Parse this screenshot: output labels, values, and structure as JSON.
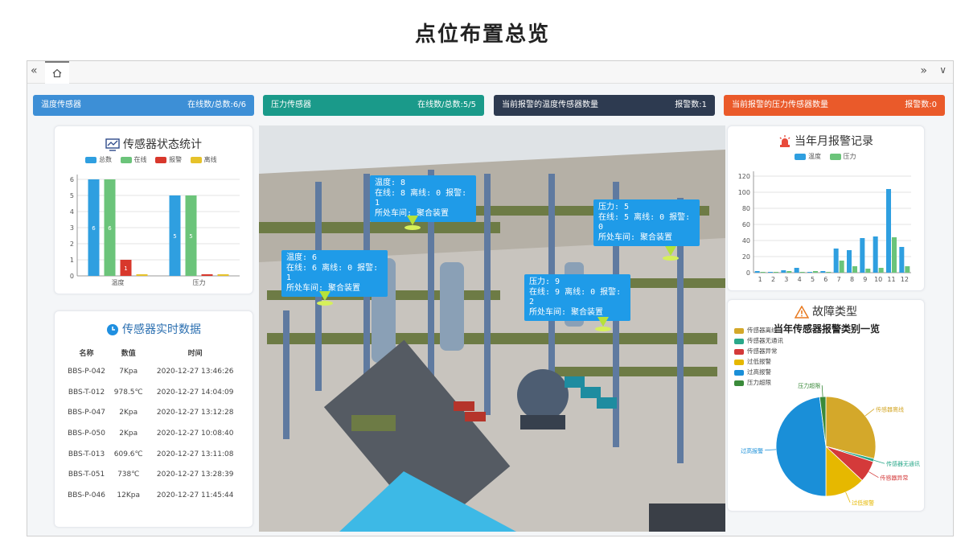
{
  "page_title": "点位布置总览",
  "tabs": {
    "prev": "«",
    "home_icon": "home-icon",
    "next": "»",
    "menu": "∨"
  },
  "stat_bars": [
    {
      "label": "温度传感器",
      "value": "在线数/总数:6/6",
      "color": "#3d8fd6"
    },
    {
      "label": "压力传感器",
      "value": "在线数/总数:5/5",
      "color": "#1a9a8a"
    },
    {
      "label": "当前报警的温度传感器数量",
      "value": "报警数:1",
      "color": "#2d3a50"
    },
    {
      "label": "当前报警的压力传感器数量",
      "value": "报警数:0",
      "color": "#ea5a2a"
    }
  ],
  "status_panel": {
    "title": "传感器状态统计",
    "icon": "monitor-chart-icon",
    "legend": [
      "总数",
      "在线",
      "报警",
      "离线"
    ],
    "legend_colors": [
      "#2f9fe0",
      "#6bc47a",
      "#d8382c",
      "#e6c22a"
    ]
  },
  "realtime_panel": {
    "title": "传感器实时数据",
    "icon": "clock-icon",
    "columns": [
      "名称",
      "数值",
      "时间"
    ],
    "rows": [
      [
        "BBS-P-042",
        "7Kpa",
        "2020-12-27 13:46:26"
      ],
      [
        "BBS-T-012",
        "978.5℃",
        "2020-12-27 14:04:09"
      ],
      [
        "BBS-P-047",
        "2Kpa",
        "2020-12-27 13:12:28"
      ],
      [
        "BBS-P-050",
        "2Kpa",
        "2020-12-27 10:08:40"
      ],
      [
        "BBS-T-013",
        "609.6℃",
        "2020-12-27 13:11:08"
      ],
      [
        "BBS-T-051",
        "738℃",
        "2020-12-27 13:28:39"
      ],
      [
        "BBS-P-046",
        "12Kpa",
        "2020-12-27 11:45:44"
      ]
    ]
  },
  "scene_popups": [
    {
      "lines": [
        "温度: 8",
        "在线: 8 离线: 0 报警: 1",
        "所处车间: 聚合装置"
      ]
    },
    {
      "lines": [
        "压力: 5",
        "在线: 5 离线: 0 报警: 0",
        "所处车间: 聚合装置"
      ]
    },
    {
      "lines": [
        "温度: 6",
        "在线: 6 离线: 0 报警: 1",
        "所处车间: 聚合装置"
      ]
    },
    {
      "lines": [
        "压力: 9",
        "在线: 9 离线: 0 报警: 2",
        "所处车间: 聚合装置"
      ]
    }
  ],
  "alarm_panel": {
    "title": "当年月报警记录",
    "icon": "alarm-light-icon",
    "legend": [
      "温度",
      "压力"
    ],
    "legend_colors": [
      "#2f9fe0",
      "#6bc47a"
    ]
  },
  "fault_panel": {
    "title": "故障类型",
    "icon": "warning-icon",
    "legend": [
      "传感器离线",
      "传感器无通讯",
      "传感器异常",
      "过低报警",
      "过高报警",
      "压力超限"
    ],
    "legend_colors": [
      "#d4a82a",
      "#2aa88a",
      "#d43a3a",
      "#e6b800",
      "#1a8fd8",
      "#3a8a3a"
    ]
  },
  "chart_data": [
    {
      "type": "bar",
      "categories": [
        "温度",
        "压力"
      ],
      "series": [
        {
          "name": "总数",
          "values": [
            6,
            5
          ]
        },
        {
          "name": "在线",
          "values": [
            6,
            5
          ]
        },
        {
          "name": "报警",
          "values": [
            1,
            0
          ]
        },
        {
          "name": "离线",
          "values": [
            0,
            0
          ]
        }
      ],
      "ylim": [
        0,
        6
      ],
      "yticks": [
        0,
        1,
        2,
        3,
        4,
        5,
        6
      ],
      "grid": true,
      "legend": "top"
    },
    {
      "type": "bar",
      "categories": [
        "1",
        "2",
        "3",
        "4",
        "5",
        "6",
        "7",
        "8",
        "9",
        "10",
        "11",
        "12"
      ],
      "series": [
        {
          "name": "温度",
          "values": [
            2,
            1,
            3,
            6,
            1,
            2,
            30,
            28,
            43,
            45,
            104,
            32
          ]
        },
        {
          "name": "压力",
          "values": [
            1,
            1,
            0,
            1,
            0,
            1,
            15,
            8,
            5,
            6,
            44,
            8
          ]
        }
      ],
      "ylim": [
        0,
        120
      ],
      "yticks": [
        0,
        20,
        40,
        60,
        80,
        100,
        120
      ],
      "grid": true,
      "legend": "top"
    },
    {
      "type": "pie",
      "title": "当年传感器报警类别一览",
      "labels": [
        "传感器离线",
        "传感器无通讯",
        "传感器异常",
        "过低报警",
        "过高报警",
        "压力超限"
      ],
      "values": [
        29,
        1,
        7,
        13,
        48,
        2
      ],
      "colors": [
        "#d4a82a",
        "#2aa88a",
        "#d43a3a",
        "#e6b800",
        "#1a8fd8",
        "#3a8a3a"
      ]
    }
  ]
}
